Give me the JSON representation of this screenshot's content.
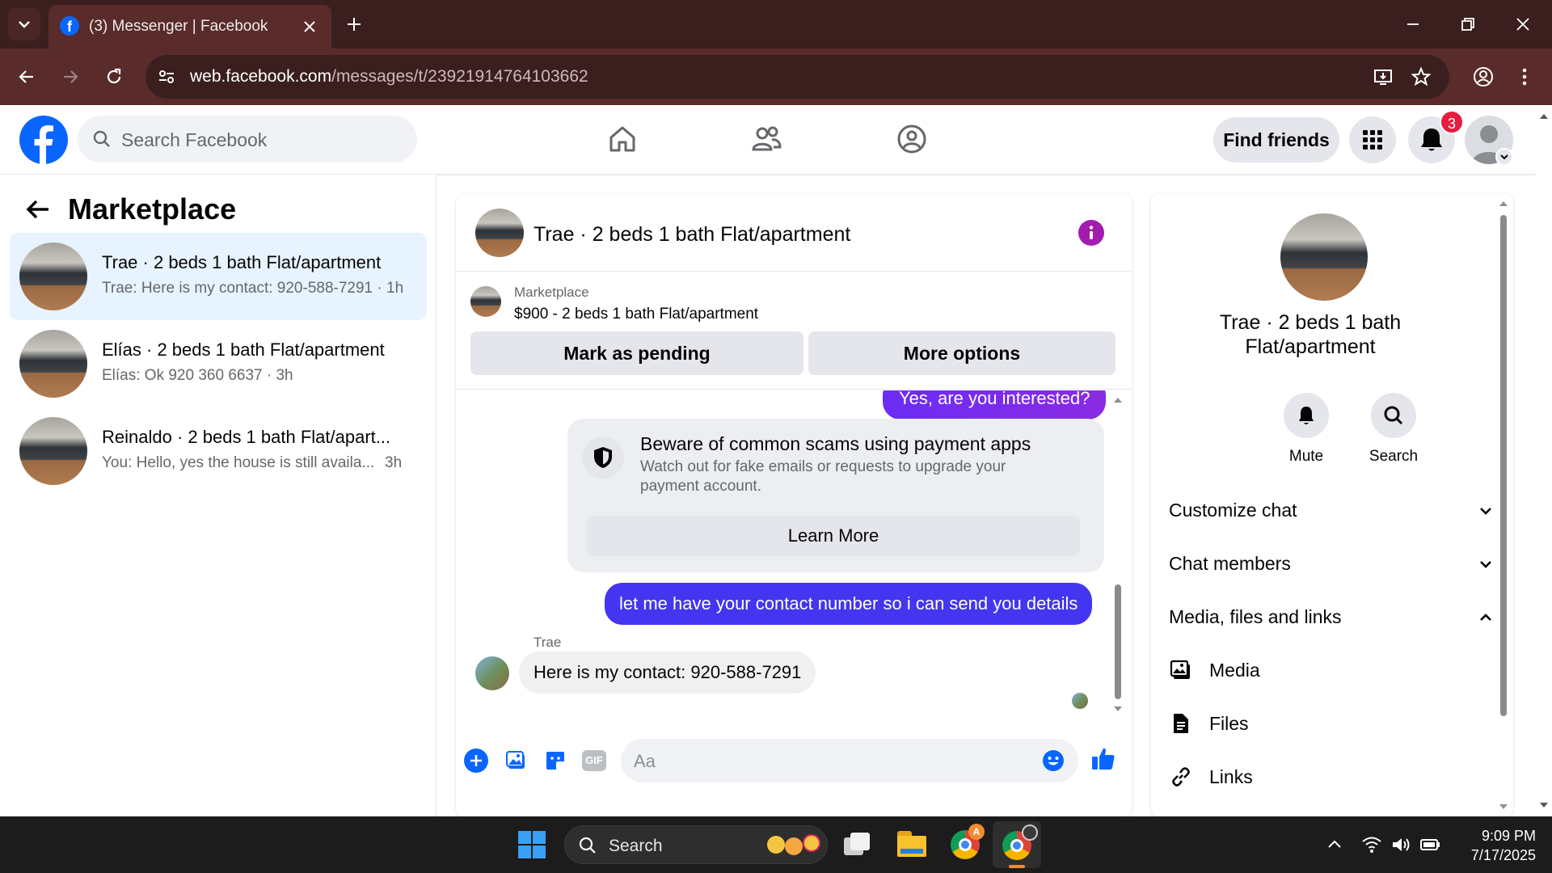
{
  "browser": {
    "tab_title": "(3) Messenger | Facebook",
    "url_domain": "web.facebook.com",
    "url_path": "/messages/t/23921914764103662"
  },
  "header": {
    "search_placeholder": "Search Facebook",
    "find_friends": "Find friends",
    "notification_count": "3"
  },
  "left": {
    "title": "Marketplace",
    "conversations": [
      {
        "name": "Trae · 2 beds 1 bath Flat/apartment",
        "preview": "Trae: Here is my contact: 920-588-7291 · 1h"
      },
      {
        "name": "Elías · 2 beds 1 bath Flat/apartment",
        "preview": "Elías: Ok 920 360 6637 · 3h"
      },
      {
        "name": "Reinaldo · 2 beds 1 bath Flat/apart...",
        "preview": "You: Hello, yes the house is still availa...",
        "time": "3h"
      }
    ]
  },
  "chat": {
    "title": "Trae · 2 beds 1 bath Flat/apartment",
    "listing_category": "Marketplace",
    "listing_price": "$900 - 2 beds 1 bath Flat/apartment",
    "mark_pending": "Mark as pending",
    "more_options": "More options",
    "msg_out_1": "Yes, are you interested?",
    "warning_title": "Beware of common scams using payment apps",
    "warning_desc": "Watch out for fake emails or requests to upgrade your payment account.",
    "learn_more": "Learn More",
    "msg_out_2": "let me have your contact number so i can send you details",
    "sender_name": "Trae",
    "msg_in_1": "Here is my contact: 920-588-7291",
    "composer_placeholder": "Aa"
  },
  "right": {
    "name": "Trae · 2 beds 1 bath Flat/apartment",
    "mute": "Mute",
    "search": "Search",
    "customize_chat": "Customize chat",
    "chat_members": "Chat members",
    "media_files_links": "Media, files and links",
    "media": "Media",
    "files": "Files",
    "links": "Links"
  },
  "taskbar": {
    "search_placeholder": "Search",
    "time": "9:09 PM",
    "date": "7/17/2025"
  },
  "colors": {
    "fb_blue": "#0866ff",
    "messenger_purple": "#a21caf",
    "outgoing_bubble": "#4335f0",
    "browser_frame": "#3b1f1f"
  }
}
